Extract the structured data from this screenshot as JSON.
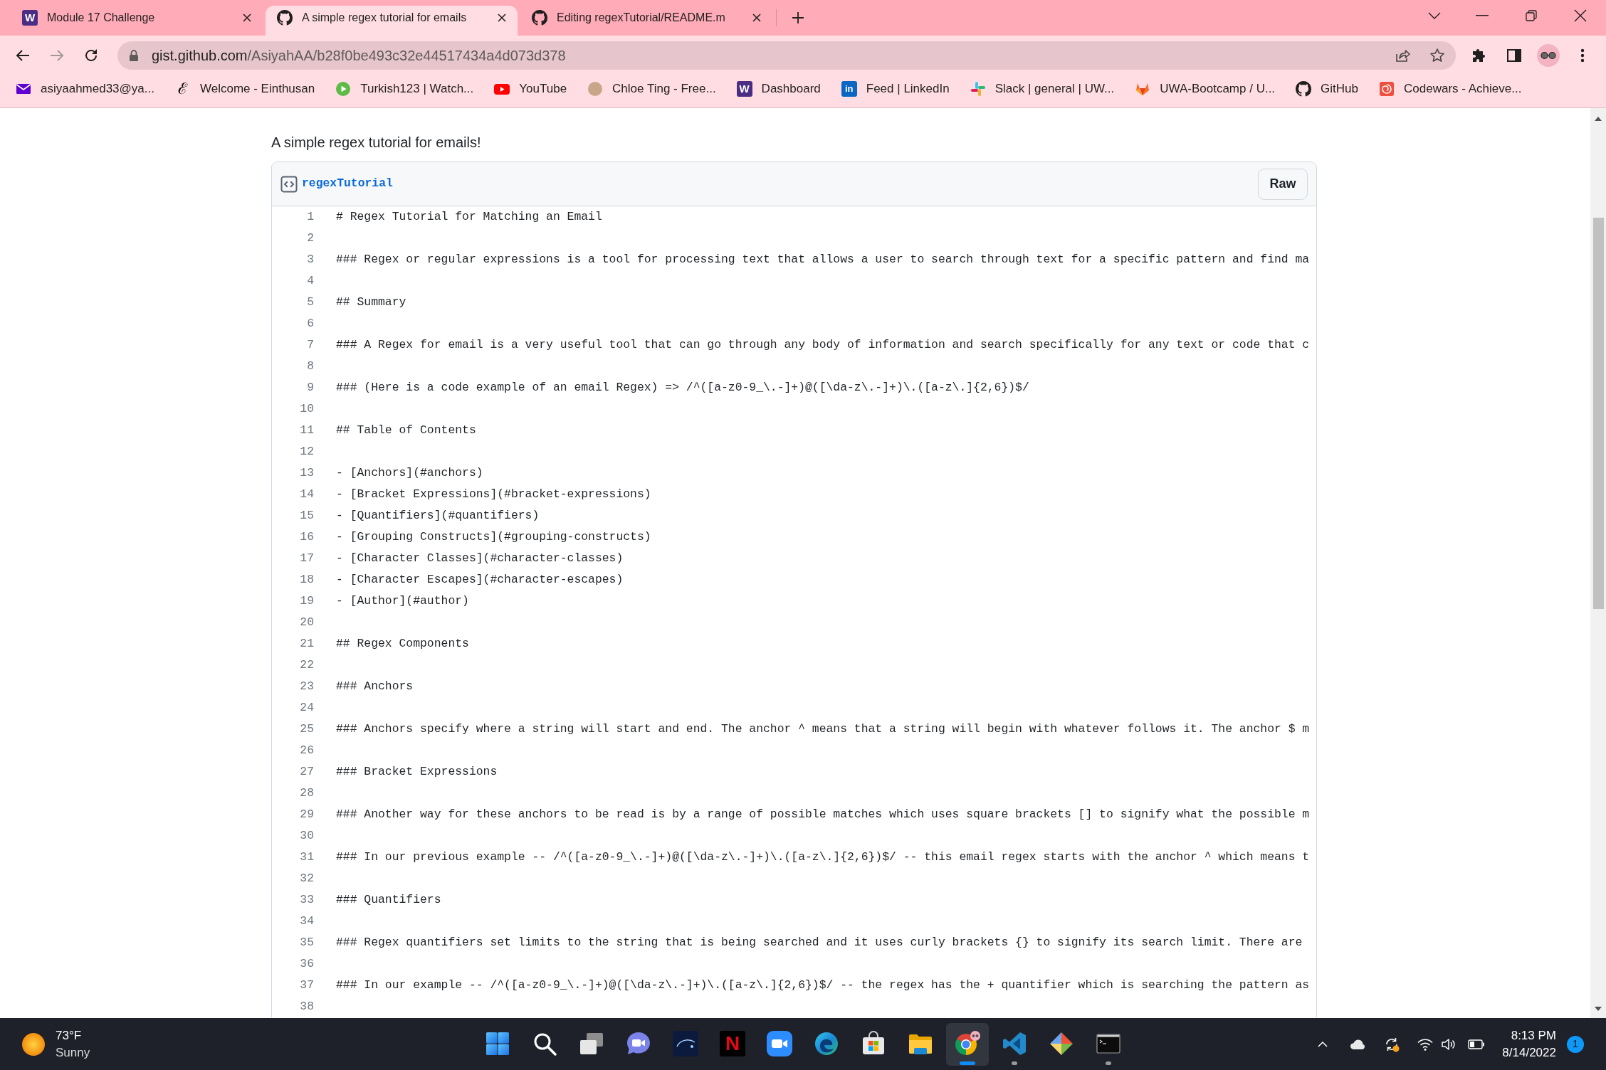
{
  "browser": {
    "tabs": [
      {
        "title": "Module 17 Challenge",
        "selected": false,
        "glyph": "W"
      },
      {
        "title": "A simple regex tutorial for emails",
        "selected": true
      },
      {
        "title": "Editing regexTutorial/README.m",
        "selected": false
      }
    ],
    "navigation": {
      "back": {
        "disabled": false
      },
      "forward": {
        "disabled": true
      }
    },
    "address_bar": {
      "host": "gist.github.com",
      "path": "/AsiyahAA/b28f0be493c32e44517434a4d073d378"
    },
    "bookmarks": [
      {
        "label": "asiyaahmed33@ya..."
      },
      {
        "label": "Welcome - Einthusan",
        "glyph": "ℰ"
      },
      {
        "label": "Turkish123 | Watch..."
      },
      {
        "label": "YouTube"
      },
      {
        "label": "Chloe Ting - Free..."
      },
      {
        "label": "Dashboard",
        "glyph": "W"
      },
      {
        "label": "Feed | LinkedIn",
        "glyph": "in"
      },
      {
        "label": "Slack | general | UW..."
      },
      {
        "label": "UWA-Bootcamp / U..."
      },
      {
        "label": "GitHub"
      },
      {
        "label": "Codewars - Achieve..."
      }
    ]
  },
  "gist": {
    "description": "A simple regex tutorial for emails!",
    "file": {
      "name": "regexTutorial",
      "raw_button": "Raw",
      "lines": [
        {
          "number": "1",
          "text": "# Regex Tutorial for Matching an Email"
        },
        {
          "number": "2"
        },
        {
          "number": "3",
          "text": "### Regex or regular expressions is a tool for processing text that allows a user to search through text for a specific pattern and find ma"
        },
        {
          "number": "4"
        },
        {
          "number": "5",
          "text": "## Summary"
        },
        {
          "number": "6"
        },
        {
          "number": "7",
          "text": "### A Regex for email is a very useful tool that can go through any body of information and search specifically for any text or code that c"
        },
        {
          "number": "8"
        },
        {
          "number": "9",
          "text": "### (Here is a code example of an email Regex) => /^([a-z0-9_\\.-]+)@([\\da-z\\.-]+)\\.([a-z\\.]{2,6})$/"
        },
        {
          "number": "10"
        },
        {
          "number": "11",
          "text": "## Table of Contents"
        },
        {
          "number": "12"
        },
        {
          "number": "13",
          "text": "- [Anchors](#anchors)"
        },
        {
          "number": "14",
          "text": "- [Bracket Expressions](#bracket-expressions)"
        },
        {
          "number": "15",
          "text": "- [Quantifiers](#quantifiers)"
        },
        {
          "number": "16",
          "text": "- [Grouping Constructs](#grouping-constructs)"
        },
        {
          "number": "17",
          "text": "- [Character Classes](#character-classes)"
        },
        {
          "number": "18",
          "text": "- [Character Escapes](#character-escapes)"
        },
        {
          "number": "19",
          "text": "- [Author](#author)"
        },
        {
          "number": "20"
        },
        {
          "number": "21",
          "text": "## Regex Components"
        },
        {
          "number": "22"
        },
        {
          "number": "23",
          "text": "### Anchors"
        },
        {
          "number": "24"
        },
        {
          "number": "25",
          "text": "### Anchors specify where a string will start and end. The anchor ^ means that a string will begin with whatever follows it. The anchor $ m"
        },
        {
          "number": "26"
        },
        {
          "number": "27",
          "text": "### Bracket Expressions"
        },
        {
          "number": "28"
        },
        {
          "number": "29",
          "text": "### Another way for these anchors to be read is by a range of possible matches which uses square brackets [] to signify what the possible m"
        },
        {
          "number": "30"
        },
        {
          "number": "31",
          "text": "### In our previous example -- /^([a-z0-9_\\.-]+)@([\\da-z\\.-]+)\\.([a-z\\.]{2,6})$/ -- this email regex starts with the anchor ^ which means t"
        },
        {
          "number": "32"
        },
        {
          "number": "33",
          "text": "### Quantifiers"
        },
        {
          "number": "34"
        },
        {
          "number": "35",
          "text": "### Regex quantifiers set limits to the string that is being searched and it uses curly brackets {} to signify its search limit. There are"
        },
        {
          "number": "36"
        },
        {
          "number": "37",
          "text": "### In our example -- /^([a-z0-9_\\.-]+)@([\\da-z\\.-]+)\\.([a-z\\.]{2,6})$/ -- the regex has the + quantifier which is searching the pattern as"
        },
        {
          "number": "38"
        }
      ]
    }
  },
  "taskbar": {
    "weather": {
      "temperature": "73°F",
      "condition": "Sunny"
    },
    "apps": [
      {
        "running": false,
        "selected": false
      },
      {
        "running": false,
        "selected": false
      },
      {
        "running": false,
        "selected": false
      },
      {
        "running": false,
        "selected": false
      },
      {
        "running": false,
        "selected": false
      },
      {
        "running": false,
        "selected": false,
        "glyph": "N"
      },
      {
        "running": false,
        "selected": false
      },
      {
        "running": false,
        "selected": false
      },
      {
        "running": false,
        "selected": false
      },
      {
        "running": false,
        "selected": false
      },
      {
        "running": true,
        "selected": true
      },
      {
        "running": true,
        "selected": false
      },
      {
        "running": false,
        "selected": false
      },
      {
        "running": true,
        "selected": false
      }
    ],
    "clock": {
      "time": "8:13 PM",
      "date": "8/14/2022"
    },
    "notification_count": "1"
  }
}
